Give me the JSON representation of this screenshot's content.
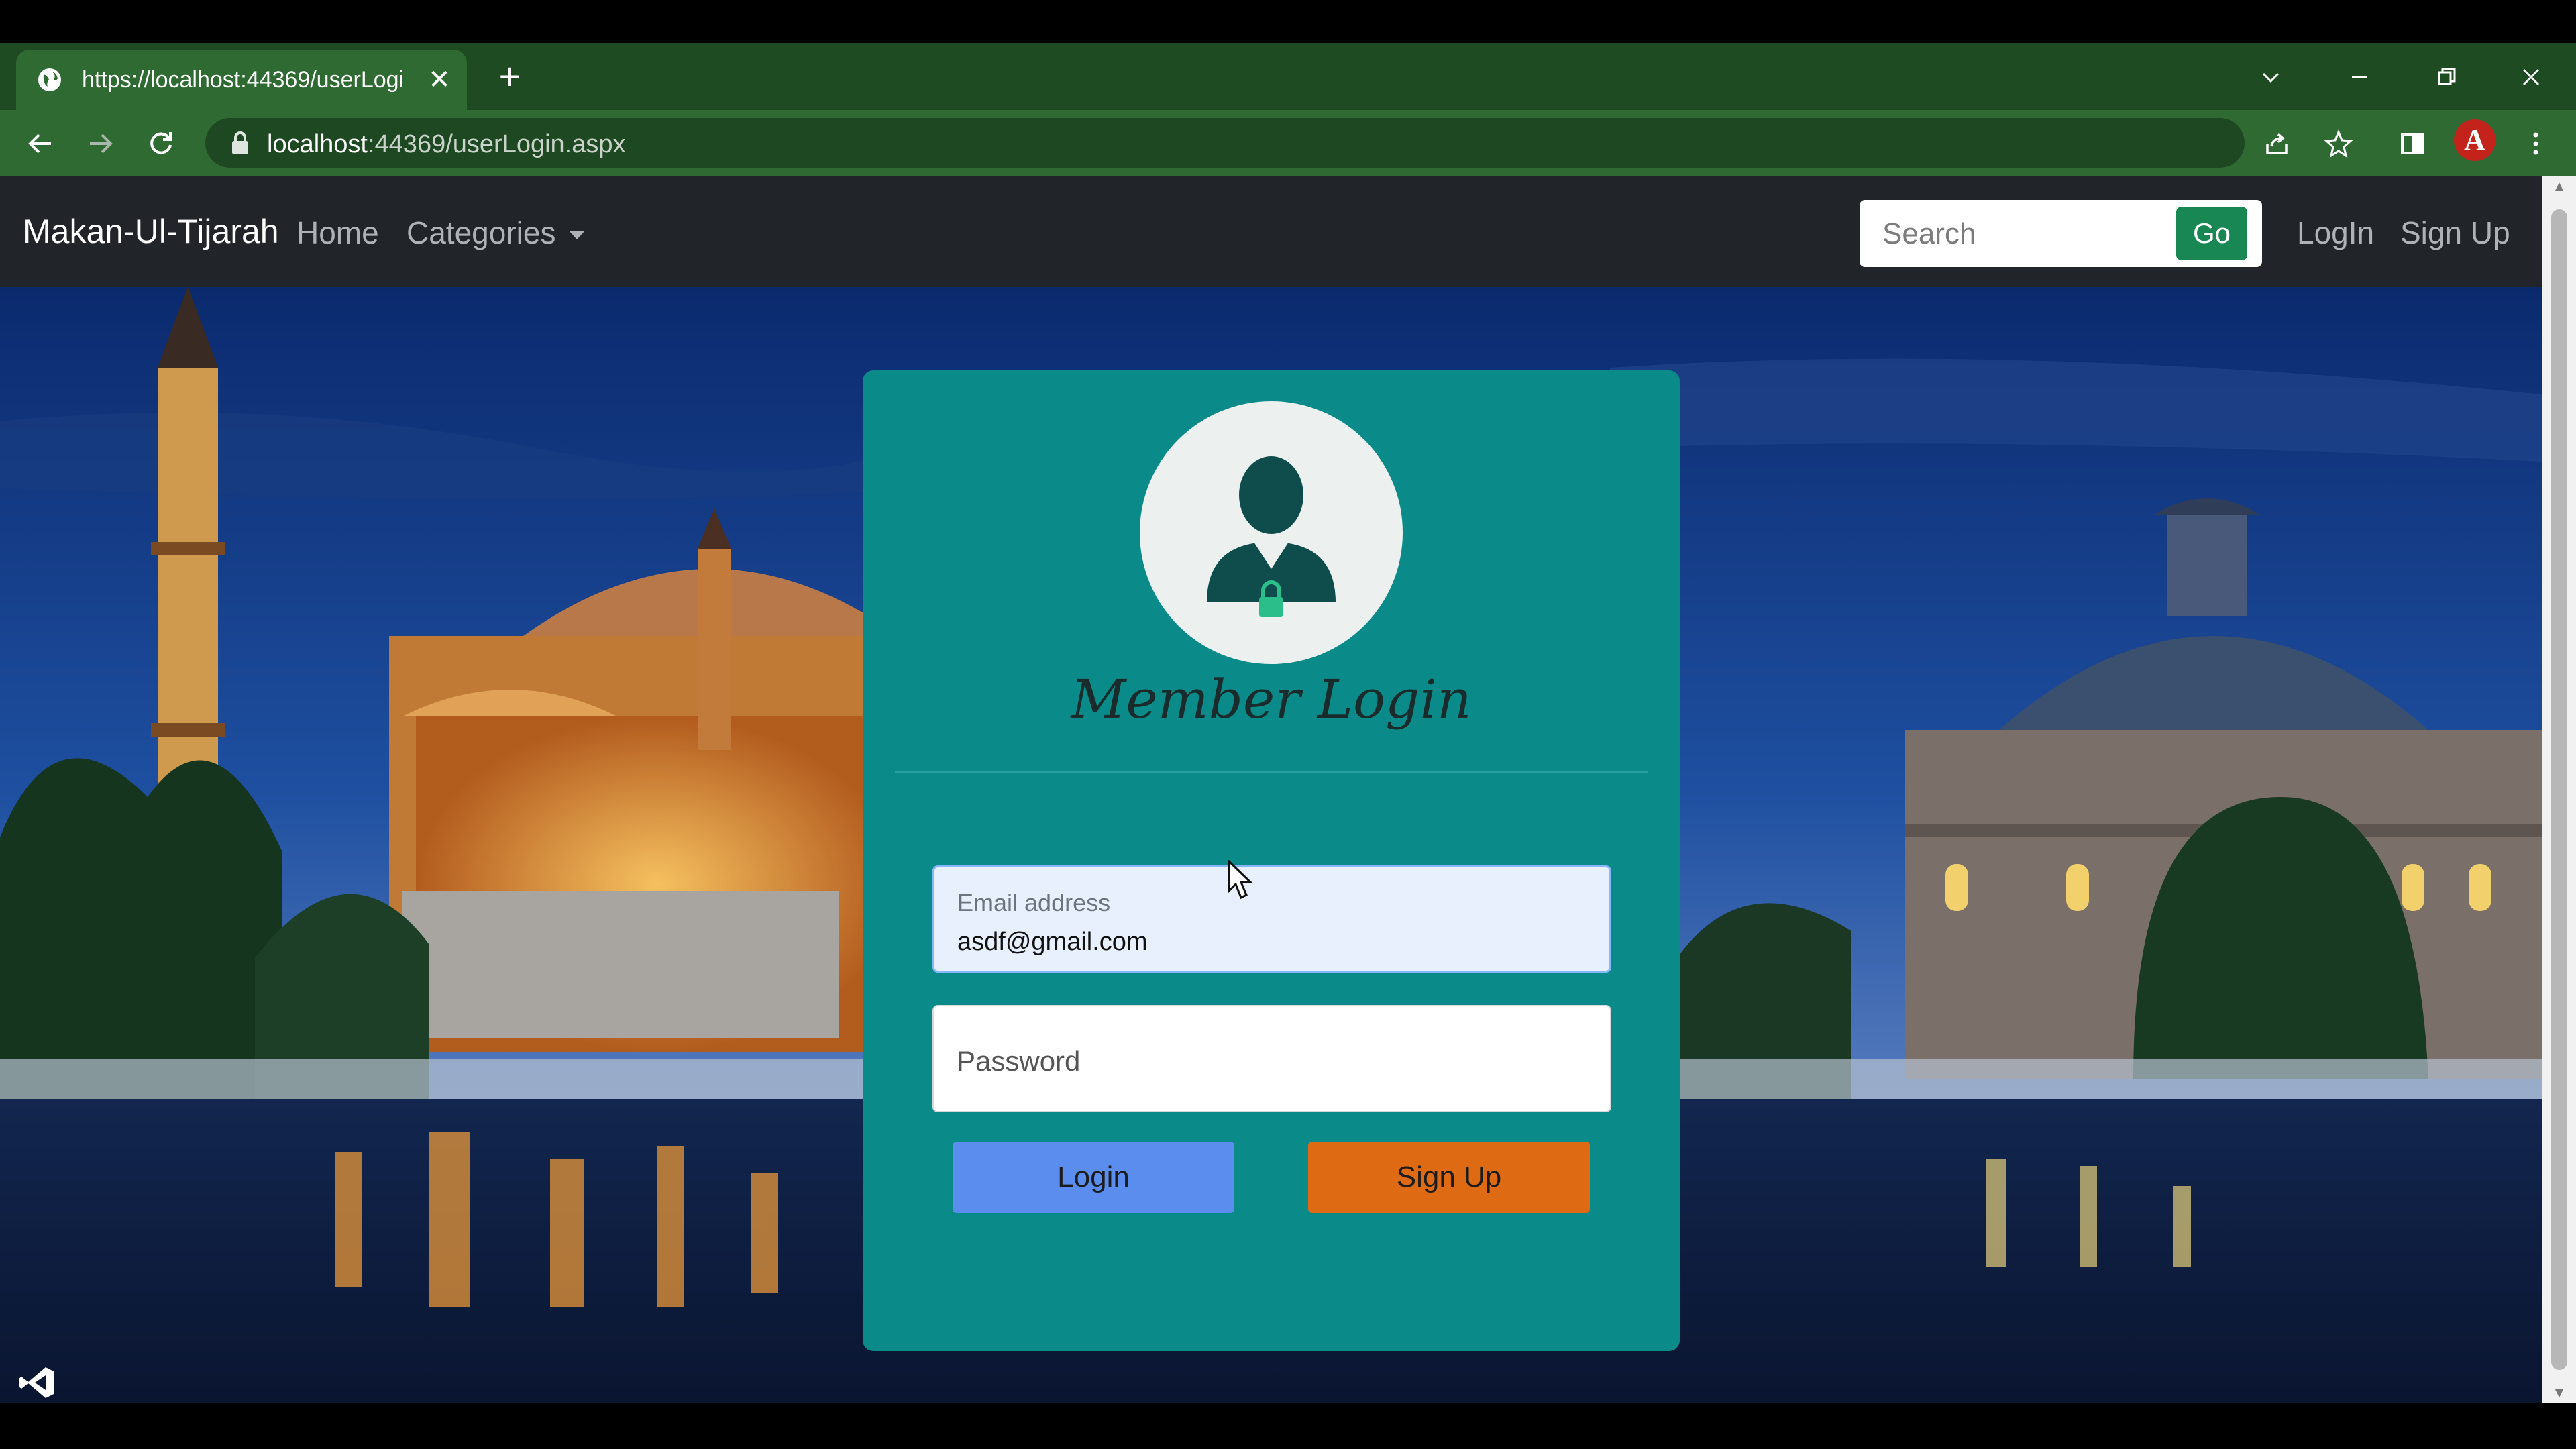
{
  "browser": {
    "tab_title": "https://localhost:44369/userLogi",
    "tab_close": "✕",
    "new_tab": "+",
    "url_host": "localhost",
    "url_rest": ":44369/userLogin.aspx",
    "profile_letter": "A"
  },
  "navbar": {
    "brand": "Makan-Ul-Tijarah",
    "home": "Home",
    "categories": "Categories",
    "search_placeholder": "Search",
    "go": "Go",
    "login": "LogIn",
    "signup": "Sign Up"
  },
  "login_card": {
    "title": "Member Login",
    "email_label": "Email address",
    "email_value": "asdf@gmail.com",
    "password_label": "Password",
    "login_button": "Login",
    "signup_button": "Sign Up"
  },
  "colors": {
    "navbar_bg": "#212529",
    "card_bg": "#0b8a8a",
    "go_button": "#198754",
    "login_button": "#5b8def",
    "signup_button": "#de6b14",
    "browser_tabbar": "#1f4b23",
    "browser_toolbar": "#2f6a32"
  },
  "icons": [
    "globe-icon",
    "close-icon",
    "plus-icon",
    "chevron-down-icon",
    "minimize-icon",
    "restore-icon",
    "back-icon",
    "forward-icon",
    "reload-icon",
    "lock-icon",
    "share-icon",
    "star-icon",
    "sidepanel-icon",
    "menu-icon",
    "user-lock-icon",
    "mouse-cursor-icon",
    "vs-code-icon"
  ]
}
